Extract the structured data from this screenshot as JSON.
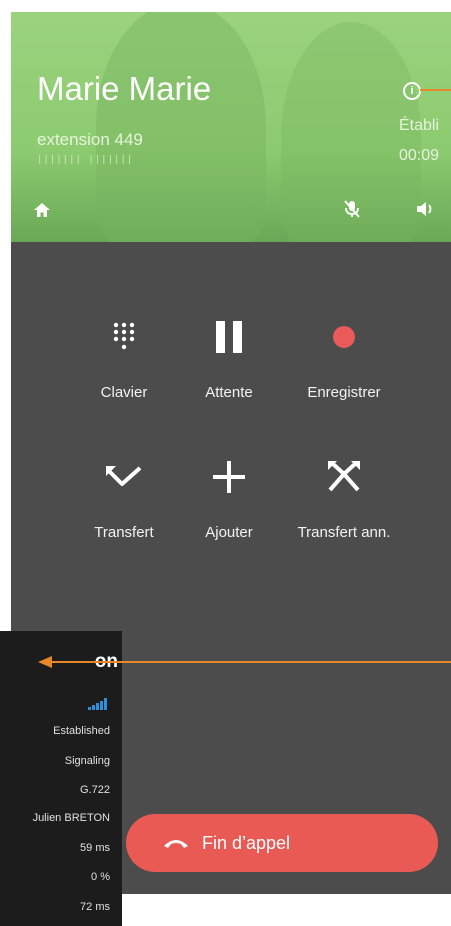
{
  "call": {
    "name": "Marie Marie",
    "extension": "extension 449",
    "extension_dots": "||||||| |||||||",
    "status": "Établi",
    "timer": "00:09"
  },
  "header_icons": [
    "home-icon",
    "microphone-muted-icon",
    "speaker-icon"
  ],
  "actions": [
    {
      "label": "Clavier",
      "icon": "keypad-icon"
    },
    {
      "label": "Attente",
      "icon": "pause-icon"
    },
    {
      "label": "Enregistrer",
      "icon": "record-icon"
    },
    {
      "label": "Transfert",
      "icon": "transfer-icon"
    },
    {
      "label": "Ajouter",
      "icon": "add-icon"
    },
    {
      "label": "Transfert ann.",
      "icon": "attended-transfer-icon"
    }
  ],
  "end_call": {
    "label": "Fin d’appel",
    "icon": "hang-up-icon"
  },
  "info_panel": {
    "title": "on",
    "rows": [
      "Established",
      "Signaling",
      "G.722",
      "Julien BRETON",
      "59 ms",
      "0 %",
      "72 ms"
    ]
  },
  "colors": {
    "header_green": "#8ccb6f",
    "background": "#4c4c4c",
    "record_red": "#ea5a5a",
    "end_call_red": "#e95a55",
    "annotation_orange": "#e8862a",
    "signal_blue": "#2d8fd8"
  }
}
